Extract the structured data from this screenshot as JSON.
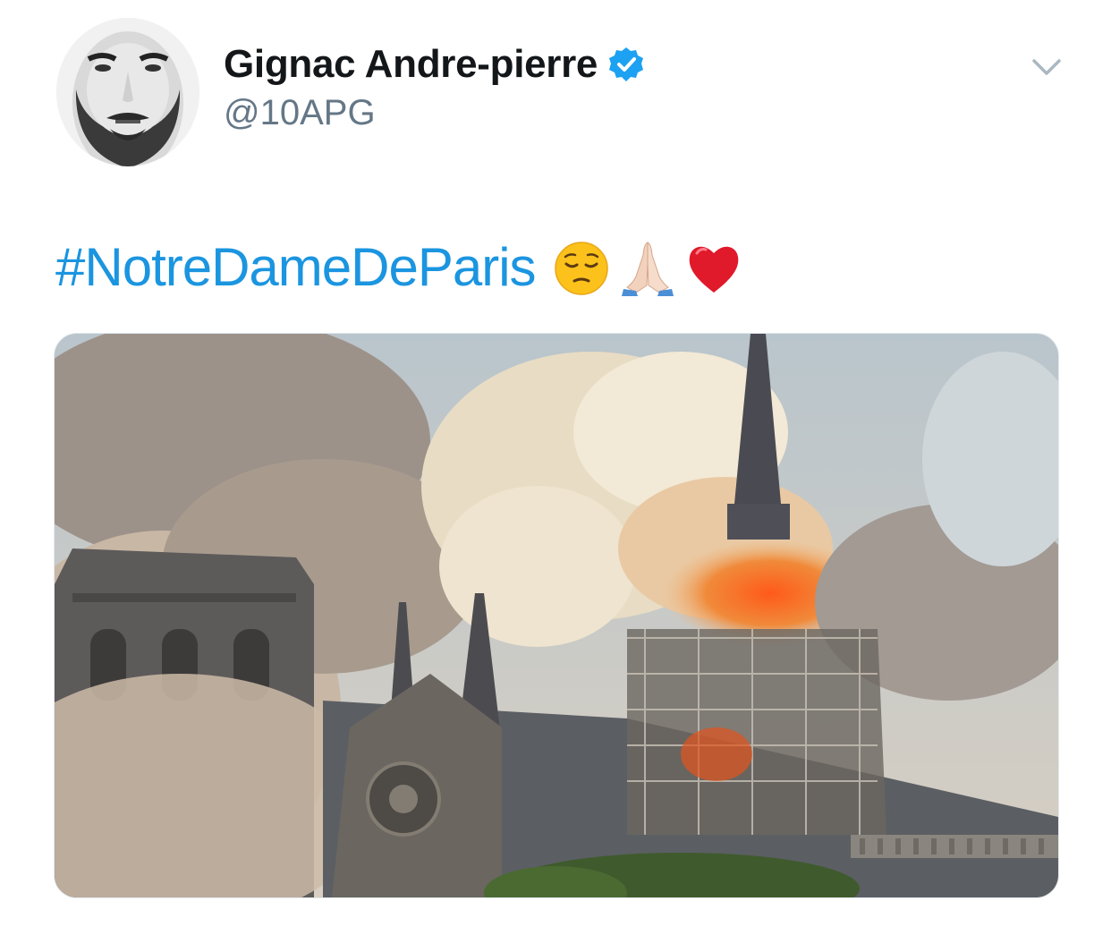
{
  "tweet": {
    "author": {
      "display_name": "Gignac Andre-pierre",
      "handle": "@10APG",
      "verified": true,
      "avatar_icon": "profile-avatar"
    },
    "menu_icon": "chevron-down-icon",
    "text": {
      "hashtag": "#NotreDameDeParis",
      "emojis": [
        "pensive-face",
        "folded-hands",
        "red-heart"
      ]
    },
    "media": {
      "type": "photo",
      "icon": "photo-cathedral-fire"
    },
    "colors": {
      "link": "#1b95e0",
      "verified": "#1da1f2",
      "handle": "#657786",
      "name": "#14171a"
    }
  }
}
